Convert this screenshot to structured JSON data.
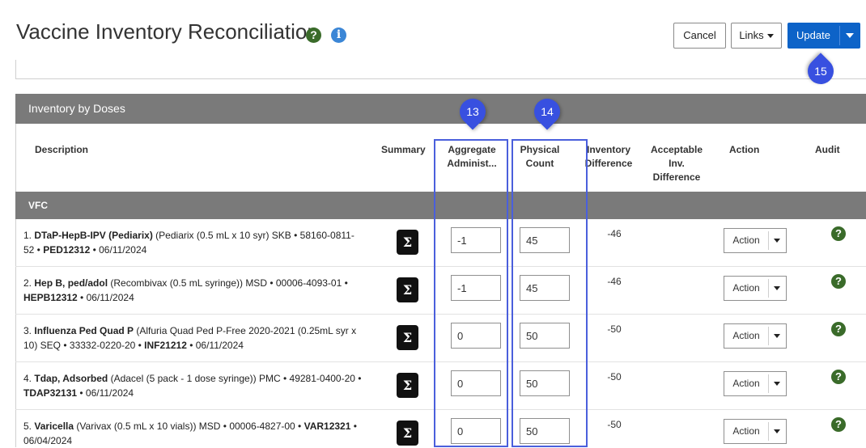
{
  "header": {
    "title": "Vaccine Inventory Reconciliation",
    "help_icon": "question-circle",
    "info_icon": "info-circle",
    "buttons": {
      "cancel": "Cancel",
      "links": "Links",
      "update": "Update"
    }
  },
  "section": {
    "title": "Inventory by Doses"
  },
  "columns": {
    "description": "Description",
    "summary": "Summary",
    "aggregate": "Aggregate Administ...",
    "physical": "Physical Count",
    "inventory_difference": "Inventory Difference",
    "acceptable": "Acceptable Inv. Difference",
    "action": "Action",
    "audit": "Audit"
  },
  "group": {
    "name": "VFC"
  },
  "rows": [
    {
      "index": "1.",
      "name": "DTaP-HepB-IPV (Pediarix)",
      "details": " (Pediarix (0.5 mL x 10 syr) SKB • 58160-0811-52 • ",
      "lot": "PED12312",
      "date": " • 06/11/2024",
      "aggregate": "-1",
      "physical": "45",
      "difference": "-46",
      "action": "Action"
    },
    {
      "index": "2.",
      "name": "Hep B, ped/adol",
      "details": " (Recombivax (0.5 mL syringe)) MSD • 00006-4093-01 • ",
      "lot": "HEPB12312",
      "date": " • 06/11/2024",
      "aggregate": "-1",
      "physical": "45",
      "difference": "-46",
      "action": "Action"
    },
    {
      "index": "3.",
      "name": "Influenza Ped Quad P",
      "details": " (Alfuria Quad Ped P-Free 2020-2021 (0.25mL syr x 10) SEQ • 33332-0220-20 • ",
      "lot": "INF21212",
      "date": " • 06/11/2024",
      "aggregate": "0",
      "physical": "50",
      "difference": "-50",
      "action": "Action"
    },
    {
      "index": "4.",
      "name": "Tdap, Adsorbed",
      "details": " (Adacel (5 pack - 1 dose syringe)) PMC • 49281-0400-20 • ",
      "lot": "TDAP32131",
      "date": " • 06/11/2024",
      "aggregate": "0",
      "physical": "50",
      "difference": "-50",
      "action": "Action"
    },
    {
      "index": "5.",
      "name": "Varicella",
      "details": " (Varivax (0.5 mL x 10 vials)) MSD • 00006-4827-00 • ",
      "lot": "VAR12321",
      "date": " • 06/04/2024",
      "aggregate": "0",
      "physical": "50",
      "difference": "-50",
      "action": "Action"
    }
  ],
  "markers": {
    "m13": "13",
    "m14": "14",
    "m15": "15"
  },
  "colors": {
    "primary": "#0d63c8",
    "section": "#7a7a7a",
    "help": "#3a6b2a",
    "marker": "#3850e0"
  }
}
